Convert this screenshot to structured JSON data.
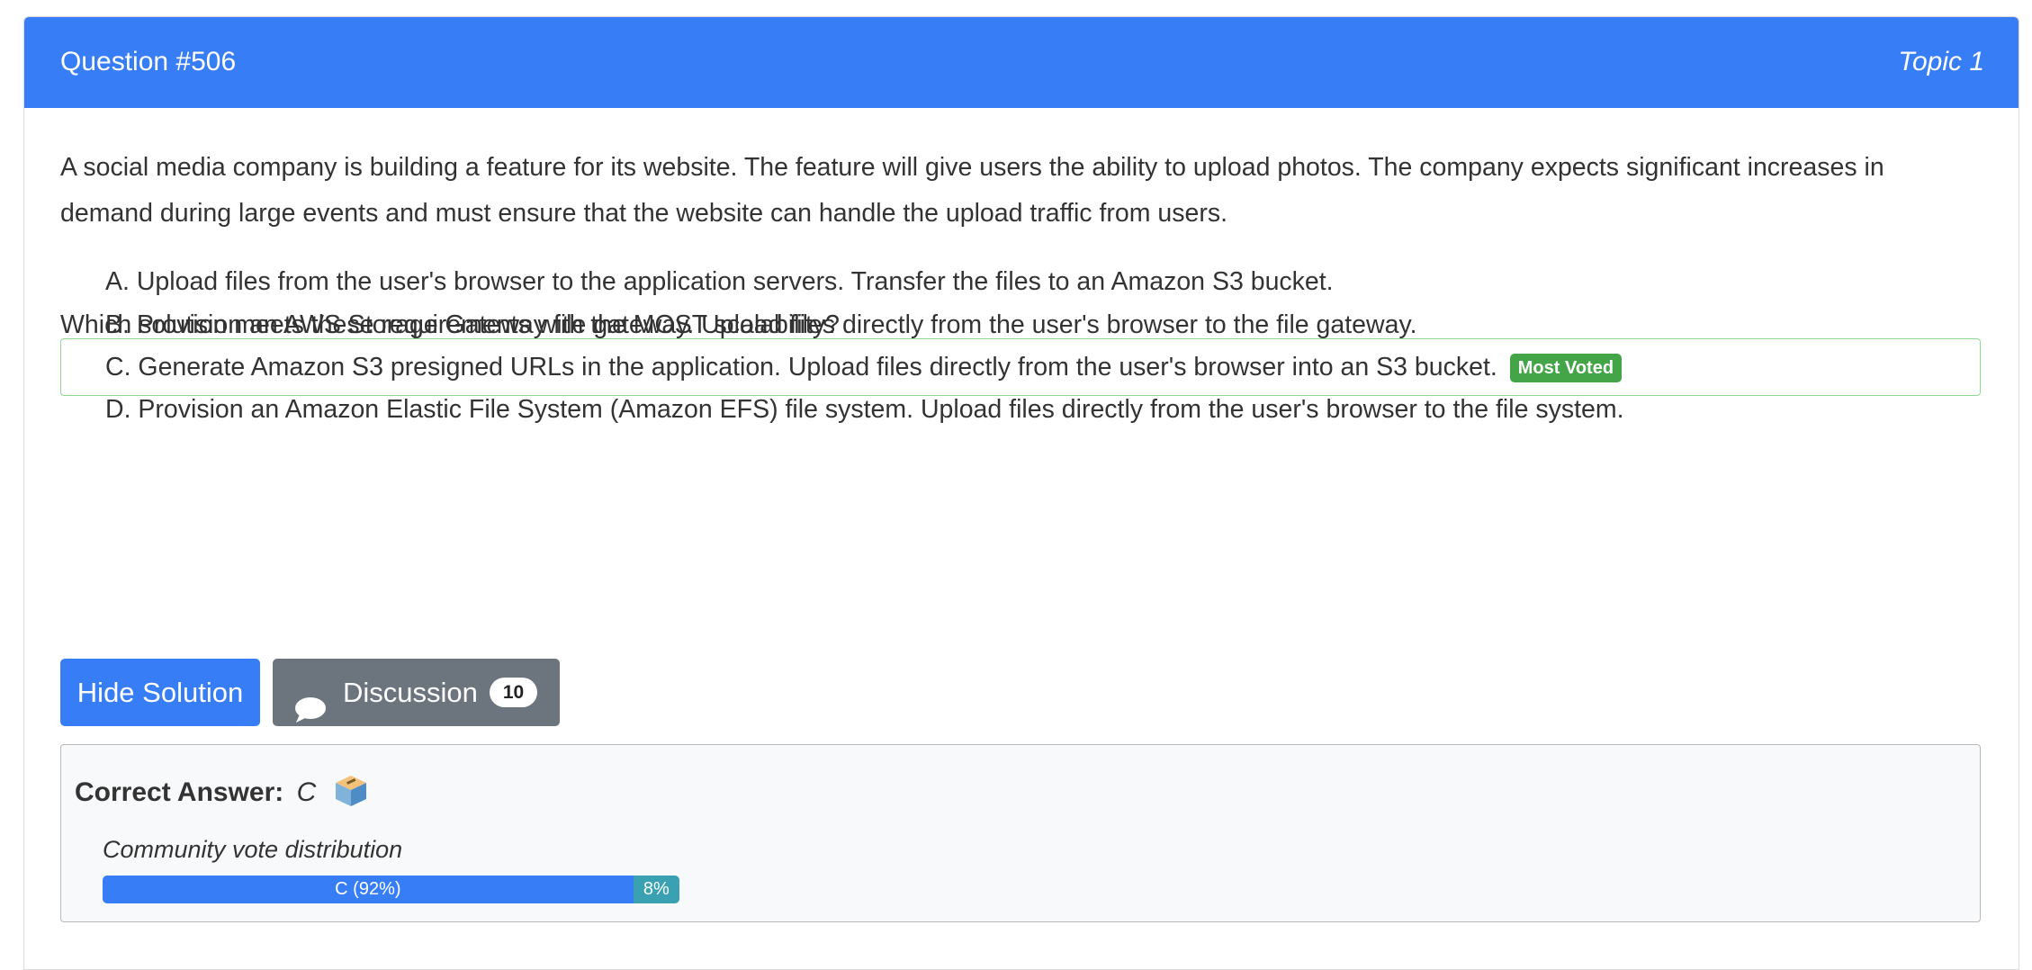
{
  "header": {
    "title": "Question #506",
    "topic": "Topic 1"
  },
  "question": {
    "text": "A social media company is building a feature for its website. The feature will give users the ability to upload photos. The company expects significant increases in demand during large events and must ensure that the website can handle the upload traffic from users.",
    "prompt": "Which solution meets these requirements with the MOST scalability?"
  },
  "choices": [
    {
      "text": "A. Upload files from the user's browser to the application servers. Transfer the files to an Amazon S3 bucket."
    },
    {
      "text": "B. Provision an AWS Storage Gateway file gateway. Upload files directly from the user's browser to the file gateway."
    },
    {
      "text": "C. Generate Amazon S3 presigned URLs in the application. Upload files directly from the user's browser into an S3 bucket.",
      "badge": "Most Voted"
    },
    {
      "text": "D. Provision an Amazon Elastic File System (Amazon EFS) file system. Upload files directly from the user's browser to the file system."
    }
  ],
  "buttons": {
    "hide_solution": "Hide Solution",
    "discussion": "Discussion",
    "discussion_count": "10"
  },
  "answer": {
    "label": "Correct Answer:",
    "value": "C",
    "distribution_label": "Community vote distribution",
    "votes": [
      {
        "label": "C (92%)",
        "percent": 92,
        "color": "#377df5"
      },
      {
        "label": "8%",
        "percent": 8,
        "color": "#3aa1b3"
      }
    ]
  },
  "colors": {
    "accent": "#377df5",
    "secondary": "#6c757d",
    "success": "#43a547",
    "correct_border": "#8ddc8d"
  },
  "icons": {
    "discussion": "chat-bubble-icon",
    "answer": "ballot-box-icon"
  }
}
